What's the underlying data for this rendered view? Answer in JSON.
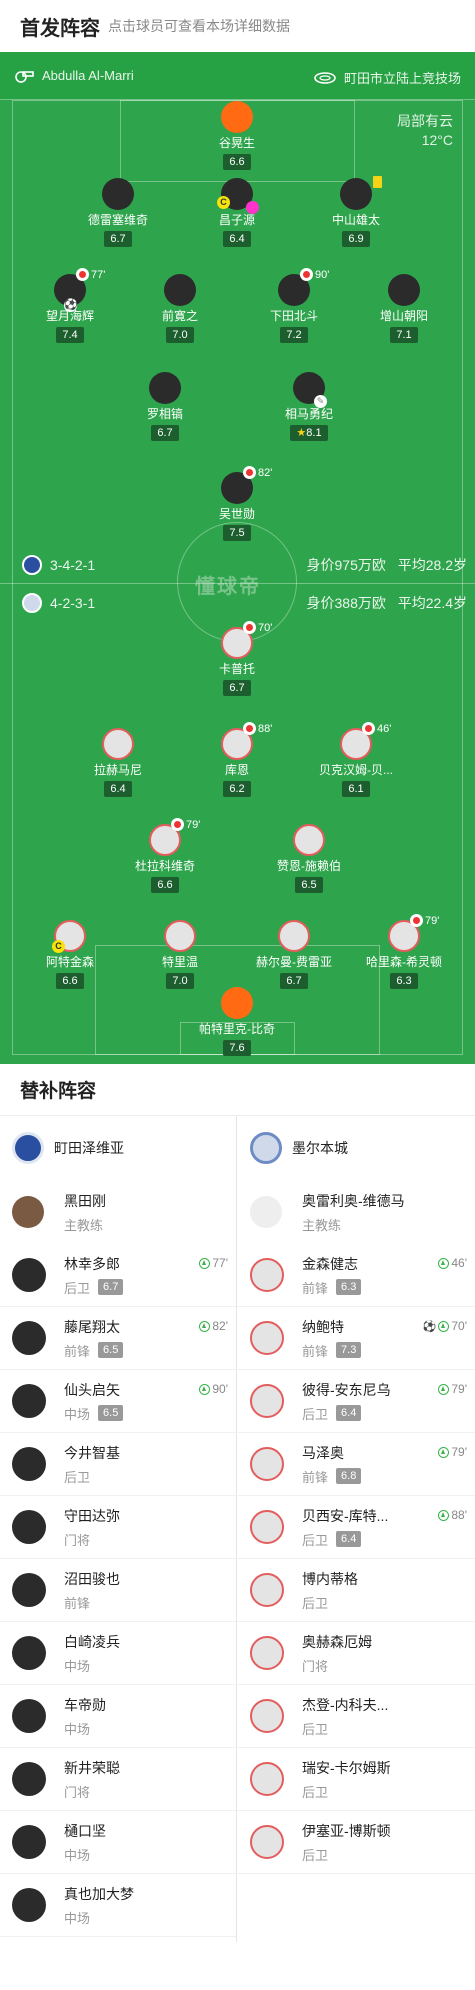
{
  "header": {
    "title": "首发阵容",
    "hint": "点击球员可查看本场详细数据"
  },
  "pitch": {
    "referee": "Abdulla Al-Marri",
    "stadium": "町田市立陆上竞技场",
    "weather": "局部有云",
    "temperature": "12°C",
    "watermark": "懂球帝",
    "home": {
      "formation": "3-4-2-1",
      "value": "身价975万欧",
      "age": "平均28.2岁"
    },
    "away": {
      "formation": "4-2-3-1",
      "value": "身价388万欧",
      "age": "平均22.4岁"
    }
  },
  "players": [
    {
      "name": "谷晃生",
      "rating": "6.6",
      "side": "gk-home"
    },
    {
      "name": "德雷塞维奇",
      "rating": "6.7",
      "side": "home"
    },
    {
      "name": "昌子源",
      "rating": "6.4",
      "side": "home"
    },
    {
      "name": "中山雄太",
      "rating": "6.9",
      "side": "home"
    },
    {
      "name": "望月海辉",
      "rating": "7.4",
      "side": "home",
      "sub": "77'"
    },
    {
      "name": "前寛之",
      "rating": "7.0",
      "side": "home"
    },
    {
      "name": "下田北斗",
      "rating": "7.2",
      "side": "home",
      "sub": "90'"
    },
    {
      "name": "增山朝阳",
      "rating": "7.1",
      "side": "home"
    },
    {
      "name": "罗相镐",
      "rating": "6.7",
      "side": "home"
    },
    {
      "name": "相马勇纪",
      "rating": "8.1",
      "side": "home"
    },
    {
      "name": "吴世勋",
      "rating": "7.5",
      "side": "home",
      "sub": "82'"
    },
    {
      "name": "卡普托",
      "rating": "6.7",
      "side": "away",
      "sub": "70'"
    },
    {
      "name": "拉赫马尼",
      "rating": "6.4",
      "side": "away"
    },
    {
      "name": "库恩",
      "rating": "6.2",
      "side": "away",
      "sub": "88'"
    },
    {
      "name": "贝克汉姆-贝...",
      "rating": "6.1",
      "side": "away",
      "sub": "46'"
    },
    {
      "name": "杜拉科维奇",
      "rating": "6.6",
      "side": "away",
      "sub": "79'"
    },
    {
      "name": "赞恩-施赖伯",
      "rating": "6.5",
      "side": "away"
    },
    {
      "name": "阿特金森",
      "rating": "6.6",
      "side": "away"
    },
    {
      "name": "特里温",
      "rating": "7.0",
      "side": "away"
    },
    {
      "name": "赫尔曼-费雷亚",
      "rating": "6.7",
      "side": "away"
    },
    {
      "name": "哈里森-希灵顿",
      "rating": "6.3",
      "side": "away",
      "sub": "79'"
    },
    {
      "name": "帕特里克-比奇",
      "rating": "7.6",
      "side": "gk-away"
    }
  ],
  "subs": {
    "title": "替补阵容",
    "home": {
      "team": "町田泽维亚",
      "coach": "黑田刚",
      "coach_role": "主教练",
      "players": [
        {
          "name": "林幸多郎",
          "pos": "后卫",
          "rating": "6.7",
          "time": "77'"
        },
        {
          "name": "藤尾翔太",
          "pos": "前锋",
          "rating": "6.5",
          "time": "82'"
        },
        {
          "name": "仙头启矢",
          "pos": "中场",
          "rating": "6.5",
          "time": "90'"
        },
        {
          "name": "今井智基",
          "pos": "后卫"
        },
        {
          "name": "守田达弥",
          "pos": "门将"
        },
        {
          "name": "沼田骏也",
          "pos": "前锋"
        },
        {
          "name": "白崎凌兵",
          "pos": "中场"
        },
        {
          "name": "车帝勋",
          "pos": "中场"
        },
        {
          "name": "新井荣聪",
          "pos": "门将"
        },
        {
          "name": "樋口坚",
          "pos": "中场"
        },
        {
          "name": "真也加大梦",
          "pos": "中场"
        }
      ]
    },
    "away": {
      "team": "墨尔本城",
      "coach": "奥雷利奥-维德马",
      "coach_role": "主教练",
      "players": [
        {
          "name": "金森健志",
          "pos": "前锋",
          "rating": "6.3",
          "time": "46'"
        },
        {
          "name": "纳鲍特",
          "pos": "前锋",
          "rating": "7.3",
          "time": "70'",
          "goal": true
        },
        {
          "name": "彼得-安东尼乌",
          "pos": "后卫",
          "rating": "6.4",
          "time": "79'"
        },
        {
          "name": "马泽奥",
          "pos": "前锋",
          "rating": "6.8",
          "time": "79'"
        },
        {
          "name": "贝西安-库特...",
          "pos": "后卫",
          "rating": "6.4",
          "time": "88'"
        },
        {
          "name": "博内蒂格",
          "pos": "后卫"
        },
        {
          "name": "奥赫森厄姆",
          "pos": "门将"
        },
        {
          "name": "杰登-内科夫...",
          "pos": "后卫"
        },
        {
          "name": "瑞安-卡尔姆斯",
          "pos": "后卫"
        },
        {
          "name": "伊塞亚-博斯顿",
          "pos": "后卫"
        }
      ]
    }
  }
}
